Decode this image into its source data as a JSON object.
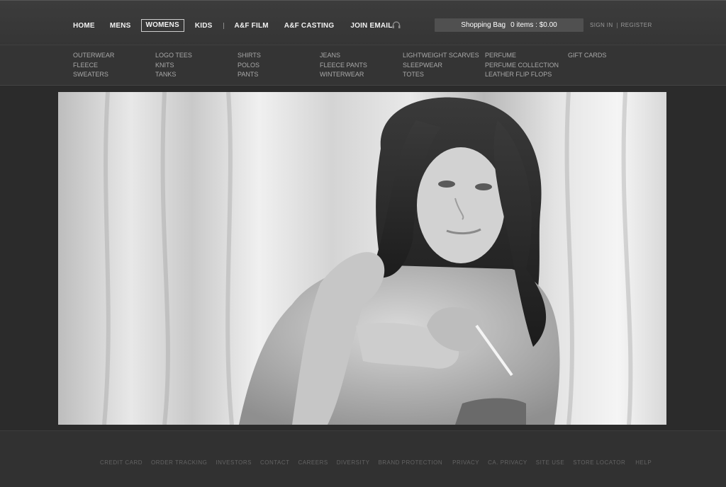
{
  "nav": {
    "items": [
      {
        "label": "HOME"
      },
      {
        "label": "MENS"
      },
      {
        "label": "WOMENS",
        "active": true
      },
      {
        "label": "KIDS"
      },
      {
        "label": "A&F FILM"
      },
      {
        "label": "A&F CASTING"
      },
      {
        "label": "JOIN EMAIL"
      }
    ],
    "headphone_icon": "headphones-icon"
  },
  "bag": {
    "label": "Shopping Bag",
    "summary": "0 items : $0.00"
  },
  "account": {
    "sign_in": "SIGN IN",
    "register": "REGISTER"
  },
  "subnav": {
    "columns": [
      [
        "OUTERWEAR",
        "FLEECE",
        "SWEATERS"
      ],
      [
        "LOGO TEES",
        "KNITS",
        "TANKS"
      ],
      [
        "SHIRTS",
        "POLOS",
        "PANTS"
      ],
      [
        "JEANS",
        "FLEECE PANTS",
        "WINTERWEAR"
      ],
      [
        "LIGHTWEIGHT SCARVES",
        "SLEEPWEAR",
        "TOTES"
      ],
      [
        "PERFUME",
        "PERFUME COLLECTION",
        "LEATHER FLIP FLOPS"
      ],
      [
        "GIFT CARDS"
      ]
    ]
  },
  "hero": {
    "image": "black-and-white photo of woman with long dark hair against curtains"
  },
  "footer": {
    "links": [
      "CREDIT CARD",
      "ORDER TRACKING",
      "INVESTORS",
      "CONTACT",
      "CAREERS",
      "DIVERSITY",
      "BRAND PROTECTION",
      "PRIVACY",
      "CA. PRIVACY",
      "SITE USE",
      "STORE LOCATOR",
      "HELP"
    ]
  },
  "colors": {
    "background": "#2a2a2a",
    "bag_bg": "#505050",
    "nav_text": "#f2f2f2",
    "subnav_text": "#a9a9a9",
    "footer_text": "#636363"
  }
}
